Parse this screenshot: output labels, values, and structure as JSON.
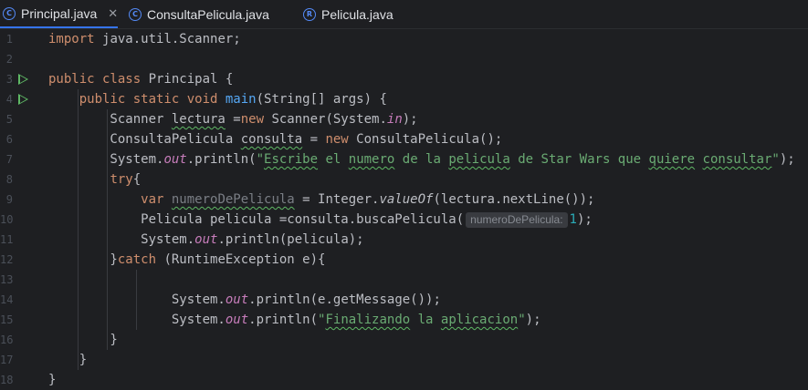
{
  "tabs": [
    {
      "label": "Principal.java",
      "icon": "class-icon"
    },
    {
      "label": "ConsultaPelicula.java",
      "icon": "class-icon"
    },
    {
      "label": "Pelicula.java",
      "icon": "record-icon"
    }
  ],
  "lines": [
    {
      "num": "1",
      "tokens": [
        [
          "kw",
          "import "
        ],
        [
          "",
          "java.util.Scanner;"
        ]
      ]
    },
    {
      "num": "2",
      "tokens": []
    },
    {
      "num": "3",
      "run": true,
      "tokens": [
        [
          "kw",
          "public class "
        ],
        [
          "",
          "Principal {"
        ]
      ]
    },
    {
      "num": "4",
      "run": true,
      "tokens": [
        [
          "",
          "    "
        ],
        [
          "kw",
          "public static void "
        ],
        [
          "fn",
          "main"
        ],
        [
          "",
          "(String[] args) {"
        ]
      ]
    },
    {
      "num": "5",
      "tokens": [
        [
          "",
          "        Scanner "
        ],
        [
          "wavy",
          "lectura"
        ],
        [
          "",
          " ="
        ],
        [
          "kw",
          "new "
        ],
        [
          "",
          "Scanner(System."
        ],
        [
          "it",
          "in"
        ],
        [
          "",
          ");"
        ]
      ]
    },
    {
      "num": "6",
      "tokens": [
        [
          "",
          "        ConsultaPelicula "
        ],
        [
          "wavy",
          "consulta"
        ],
        [
          "",
          " = "
        ],
        [
          "kw",
          "new "
        ],
        [
          "",
          "ConsultaPelicula();"
        ]
      ]
    },
    {
      "num": "7",
      "tokens": [
        [
          "",
          "        System."
        ],
        [
          "it",
          "out"
        ],
        [
          "",
          ".println("
        ],
        [
          "st",
          "\""
        ],
        [
          "stw",
          "Escribe"
        ],
        [
          "st",
          " el "
        ],
        [
          "stw",
          "numero"
        ],
        [
          "st",
          " de la "
        ],
        [
          "stw",
          "pelicula"
        ],
        [
          "st",
          " de Star Wars que "
        ],
        [
          "stw",
          "quiere"
        ],
        [
          "st",
          " "
        ],
        [
          "stw",
          "consultar"
        ],
        [
          "st",
          "\""
        ],
        [
          "",
          ");"
        ]
      ]
    },
    {
      "num": "8",
      "tokens": [
        [
          "",
          "        "
        ],
        [
          "kw",
          "try"
        ],
        [
          "",
          "{"
        ]
      ]
    },
    {
      "num": "9",
      "tokens": [
        [
          "",
          "            "
        ],
        [
          "kw",
          "var "
        ],
        [
          "graywavy",
          "numeroDePelicula"
        ],
        [
          "",
          " = Integer."
        ],
        [
          "sm",
          "valueOf"
        ],
        [
          "",
          "(lectura.nextLine());"
        ]
      ]
    },
    {
      "num": "10",
      "tokens": [
        [
          "",
          "            Pelicula pelicula =consulta.buscaPelicula("
        ],
        [
          "hint",
          "numeroDePelicula:"
        ],
        [
          "nm",
          "1"
        ],
        [
          "",
          ");"
        ]
      ]
    },
    {
      "num": "11",
      "tokens": [
        [
          "",
          "            System."
        ],
        [
          "it",
          "out"
        ],
        [
          "",
          ".println(pelicula);"
        ]
      ]
    },
    {
      "num": "12",
      "tokens": [
        [
          "",
          "        }"
        ],
        [
          "kw",
          "catch "
        ],
        [
          "",
          "(RuntimeException e){"
        ]
      ]
    },
    {
      "num": "13",
      "tokens": []
    },
    {
      "num": "14",
      "tokens": [
        [
          "",
          "                System."
        ],
        [
          "it",
          "out"
        ],
        [
          "",
          ".println(e.getMessage());"
        ]
      ]
    },
    {
      "num": "15",
      "tokens": [
        [
          "",
          "                System."
        ],
        [
          "it",
          "out"
        ],
        [
          "",
          ".println("
        ],
        [
          "st",
          "\""
        ],
        [
          "stw",
          "Finalizando"
        ],
        [
          "st",
          " la "
        ],
        [
          "stw",
          "aplicacion"
        ],
        [
          "st",
          "\""
        ],
        [
          "",
          ");"
        ]
      ]
    },
    {
      "num": "16",
      "tokens": [
        [
          "",
          "        }"
        ]
      ]
    },
    {
      "num": "17",
      "tokens": [
        [
          "",
          "    }"
        ]
      ]
    },
    {
      "num": "18",
      "tokens": [
        [
          "",
          "}"
        ]
      ]
    }
  ]
}
